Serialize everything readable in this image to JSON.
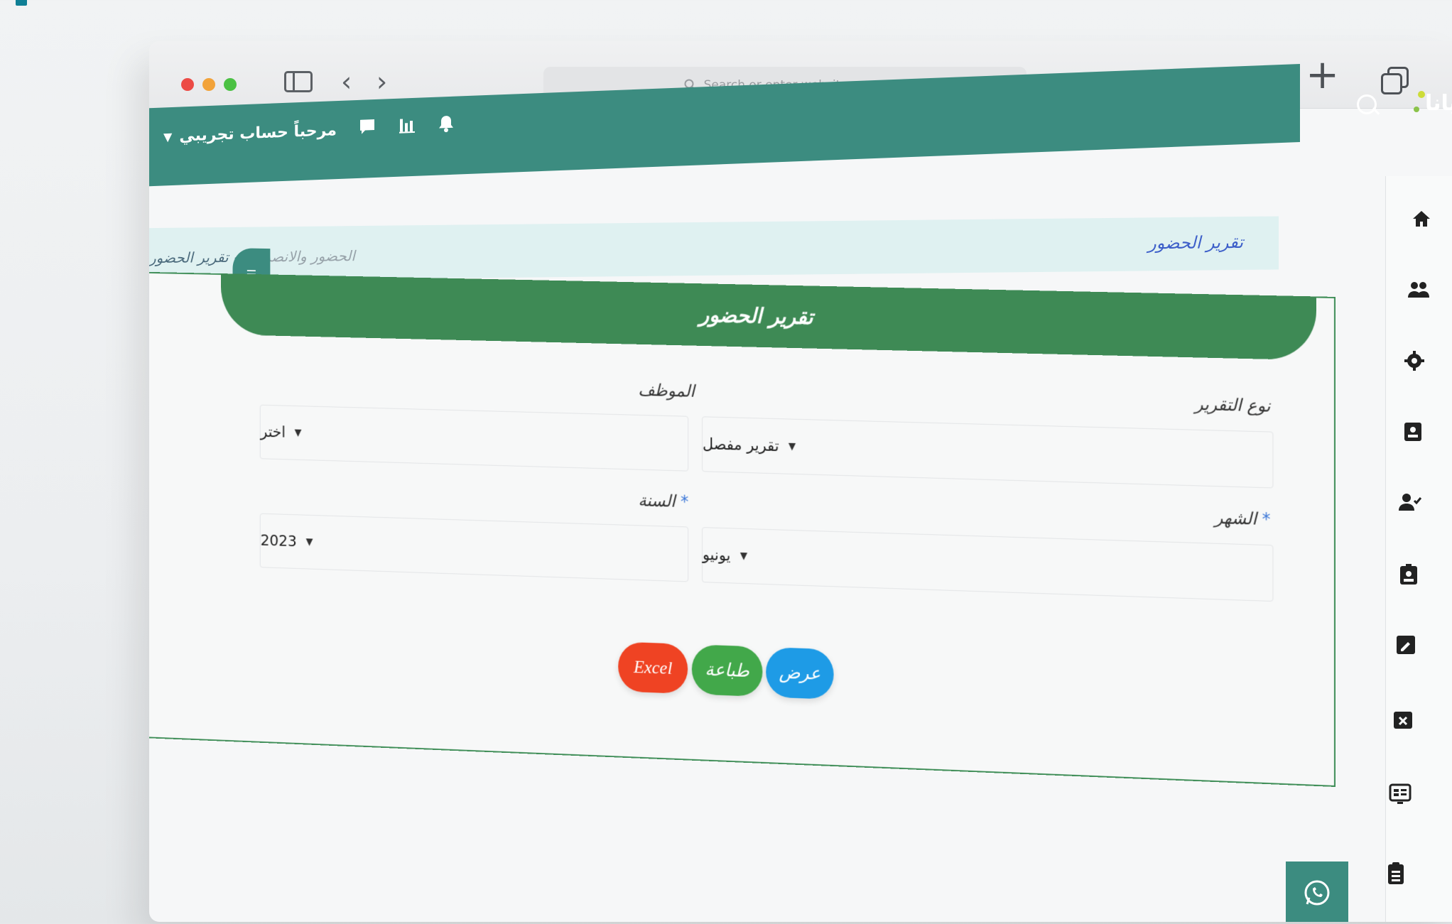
{
  "browser": {
    "address_placeholder": "Search or enter website name",
    "back": "‹",
    "forward": "›",
    "new_tab": "+"
  },
  "header": {
    "user_greeting": "مرحباً حساب تجريبي",
    "logo_text": "يانا",
    "brand_color": "#3c8c80"
  },
  "breadcrumb": {
    "page_heading": "تقرير الحضور",
    "parent": "الحضور والانصراف",
    "separator": "-",
    "current": "تقرير الحضور"
  },
  "form": {
    "title": "تقرير الحضور",
    "report_type": {
      "label": "نوع التقرير",
      "value": "تقرير مفصل"
    },
    "employee": {
      "label": "الموظف",
      "value": "اختر"
    },
    "month": {
      "label": "الشهر",
      "required_mark": "*",
      "value": "يونيو"
    },
    "year": {
      "label": "السنة",
      "required_mark": "*",
      "value": "2023"
    }
  },
  "buttons": {
    "view": "عرض",
    "print": "طباعة",
    "excel": "Excel",
    "view_color": "#1e9be6",
    "print_color": "#42a84a",
    "excel_color": "#ef4323"
  },
  "rail_icons": [
    "home-icon",
    "users-icon",
    "gear-icon",
    "contact-card-icon",
    "user-check-icon",
    "badge-icon",
    "edit-note-icon",
    "calendar-x-icon",
    "screen-list-icon",
    "clipboard-icon",
    "bar-chart-icon"
  ]
}
